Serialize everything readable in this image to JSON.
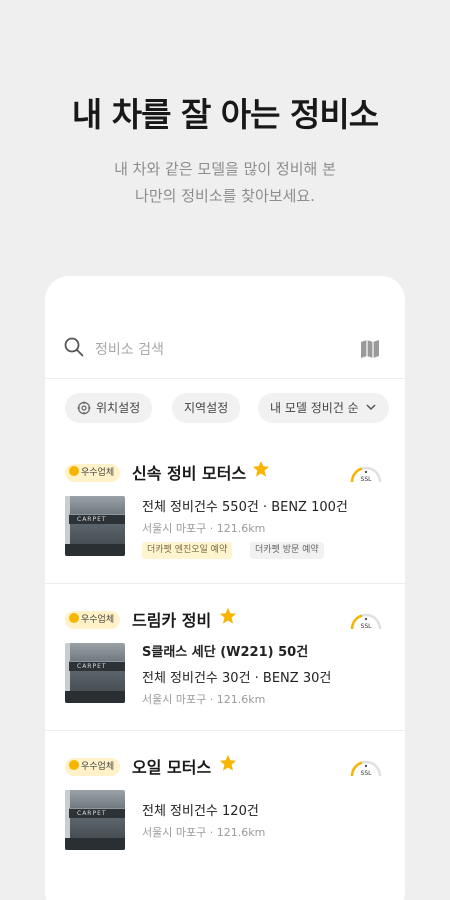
{
  "hero": {
    "title": "내 차를 잘 아는 정비소",
    "subtitle_line1": "내 차와 같은 모델을 많이 정비해 본",
    "subtitle_line2": "나만의 정비소를 찾아보세요."
  },
  "search": {
    "placeholder": "정비소 검색"
  },
  "filters": [
    "위치설정",
    "지역설정",
    "내 모델 정비건 순"
  ],
  "shops": [
    {
      "badge": "우수업체",
      "name": "신속 정비 모터스",
      "stats": "전체 정비건수 550건 · BENZ 100건",
      "address": "서울시 마포구 · 121.6km",
      "tags": [
        "더카펫 엔진오일 예약",
        "더카펫 방문 예약"
      ],
      "gauge_label": "SSL",
      "thumb_sign": "CARPET"
    },
    {
      "badge": "우수업체",
      "name": "드림카 정비",
      "model_stat": "S클래스 세단 (W221) 50건",
      "stats": "전체 정비건수 30건 · BENZ 30건",
      "address": "서울시 마포구 · 121.6km",
      "gauge_label": "SSL",
      "thumb_sign": "CARPET"
    },
    {
      "badge": "우수업체",
      "name": "오일 모터스",
      "stats": "전체 정비건수 120건",
      "address": "서울시 마포구 · 121.6km",
      "gauge_label": "SSL",
      "thumb_sign": "CARPET"
    }
  ],
  "colors": {
    "accent": "#f7b500",
    "badge_bg": "#fff2c8",
    "page_bg": "#efefef"
  }
}
